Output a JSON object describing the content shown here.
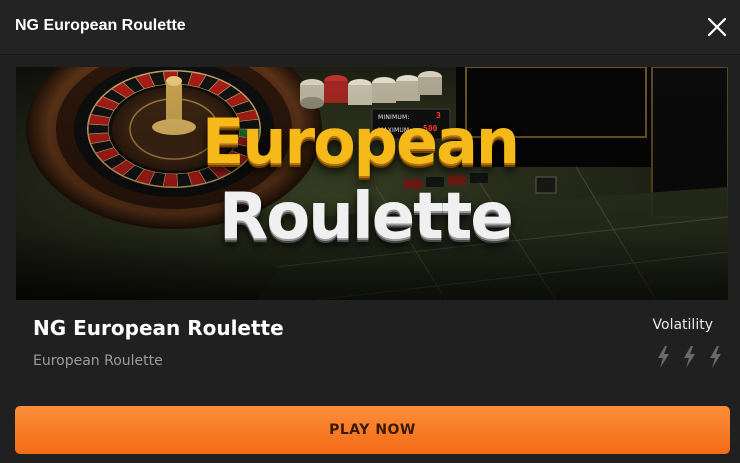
{
  "header": {
    "title": "NG European Roulette"
  },
  "banner": {
    "headline_line1": "European",
    "headline_line2": "Roulette",
    "limits": {
      "minimum_label": "MINIMUM:",
      "minimum_value": "3",
      "maximum_label": "MAXIMUM:",
      "maximum_value": "500"
    }
  },
  "game": {
    "title": "NG European Roulette",
    "subtitle": "European Roulette",
    "volatility_label": "Volatility",
    "volatility_icon": "lightning-icon",
    "volatility_level": 3,
    "volatility_max": 3
  },
  "actions": {
    "play_label": "PLAY NOW"
  },
  "colors": {
    "background": "#202020",
    "accent": "#f47a25",
    "title_gold": "#f6b91a"
  }
}
